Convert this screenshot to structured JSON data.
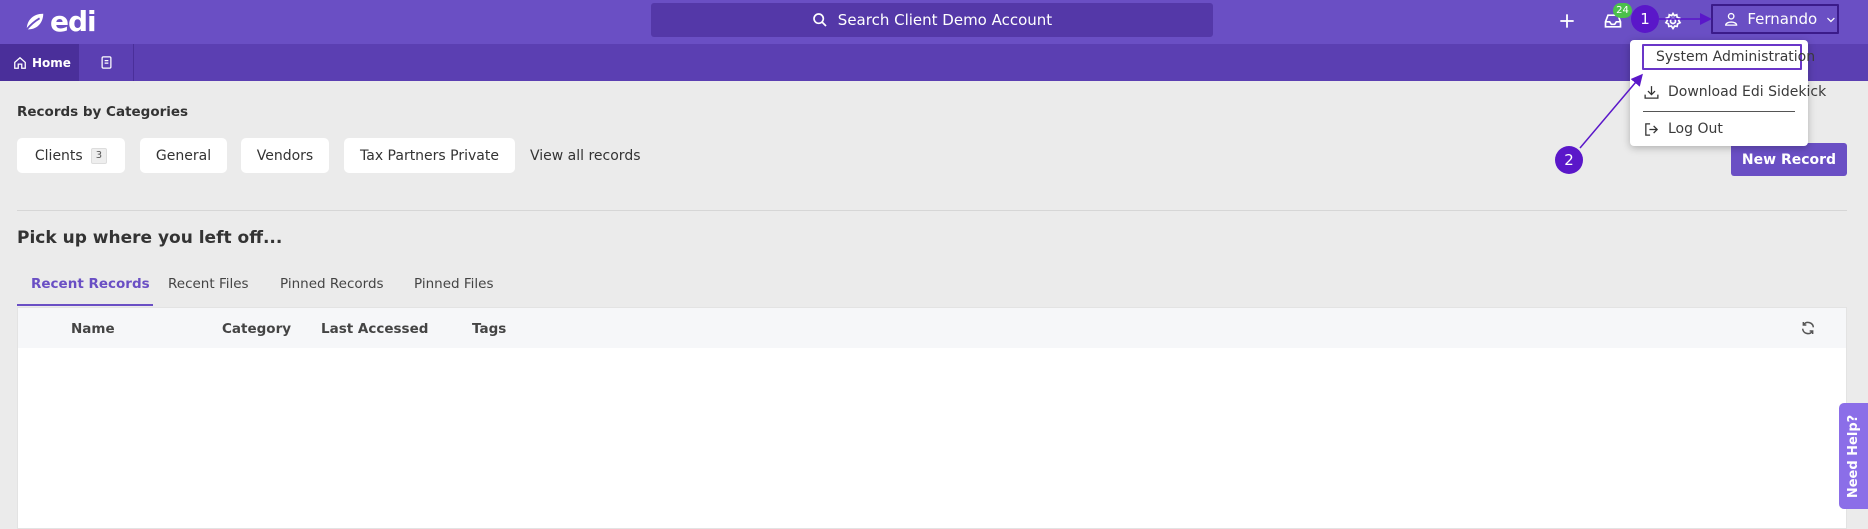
{
  "app": {
    "logo_text": "edi"
  },
  "header": {
    "search_label": "Search Client Demo Account",
    "notifications_count": "24",
    "user_name": "Fernando"
  },
  "nav": {
    "home_label": "Home"
  },
  "user_dropdown": {
    "items": [
      {
        "label": "System Administration",
        "icon": "document-icon"
      },
      {
        "label": "Download Edi Sidekick",
        "icon": "download-icon"
      },
      {
        "label": "Log Out",
        "icon": "logout-icon"
      }
    ]
  },
  "annotations": {
    "step1": "1",
    "step2": "2"
  },
  "categories": {
    "title": "Records by Categories",
    "chips": [
      {
        "label": "Clients",
        "count": "3"
      },
      {
        "label": "General"
      },
      {
        "label": "Vendors"
      },
      {
        "label": "Tax Partners Private"
      }
    ],
    "view_all_label": "View all records",
    "new_record_label": "New Record"
  },
  "recent": {
    "title": "Pick up where you left off...",
    "tabs": [
      "Recent Records",
      "Recent Files",
      "Pinned Records",
      "Pinned Files"
    ],
    "active_tab": "Recent Records",
    "columns": [
      "Name",
      "Category",
      "Last Accessed",
      "Tags"
    ]
  },
  "help": {
    "label": "Need Help?"
  },
  "colors": {
    "brand": "#6a4fc4",
    "brand_dark": "#5b3fb2",
    "annotation": "#5a17c9",
    "badge": "#4bc04b"
  }
}
